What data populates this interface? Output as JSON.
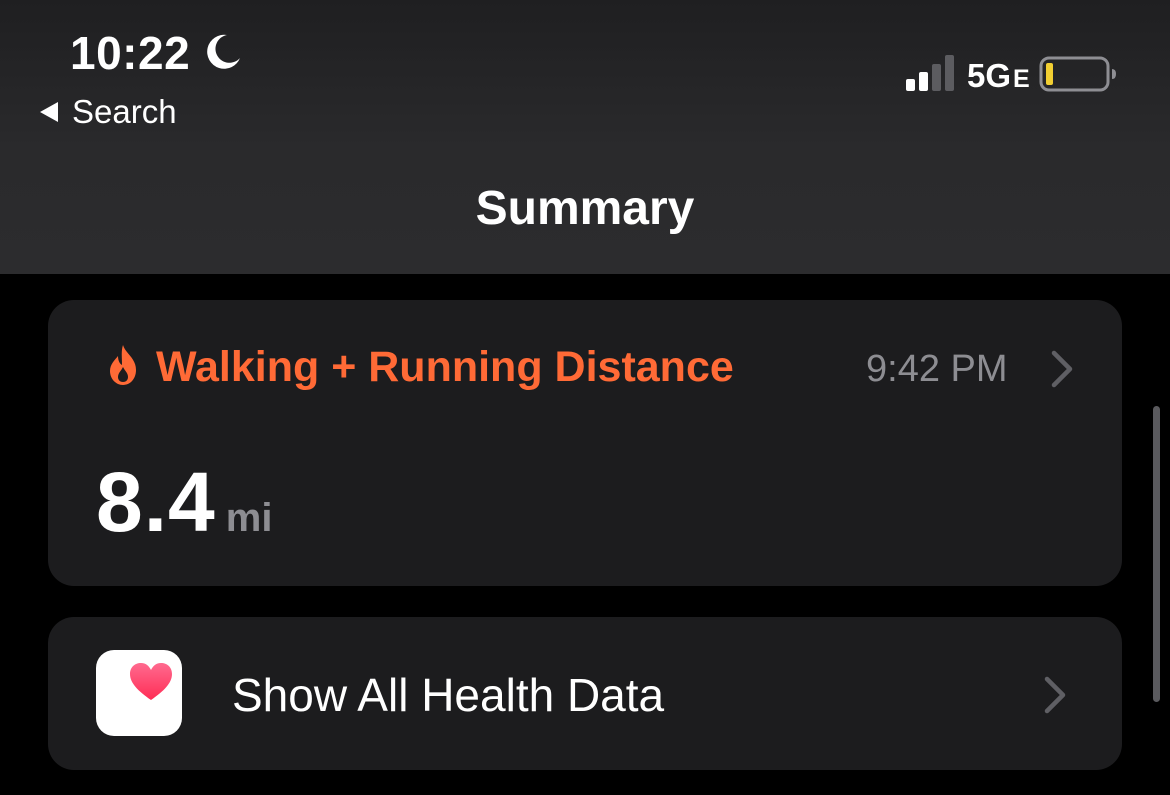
{
  "status_bar": {
    "time": "10:22",
    "network": "5G",
    "network_suffix": "E",
    "battery_color": "#f2cf32"
  },
  "nav": {
    "back_label": "Search",
    "title": "Summary"
  },
  "metric_card": {
    "title": "Walking + Running Distance",
    "time": "9:42 PM",
    "value": "8.4",
    "unit": "mi",
    "accent_color": "#ff6a36",
    "icon": "flame-icon"
  },
  "health_row": {
    "label": "Show All Health Data",
    "icon": "health-app-icon"
  }
}
